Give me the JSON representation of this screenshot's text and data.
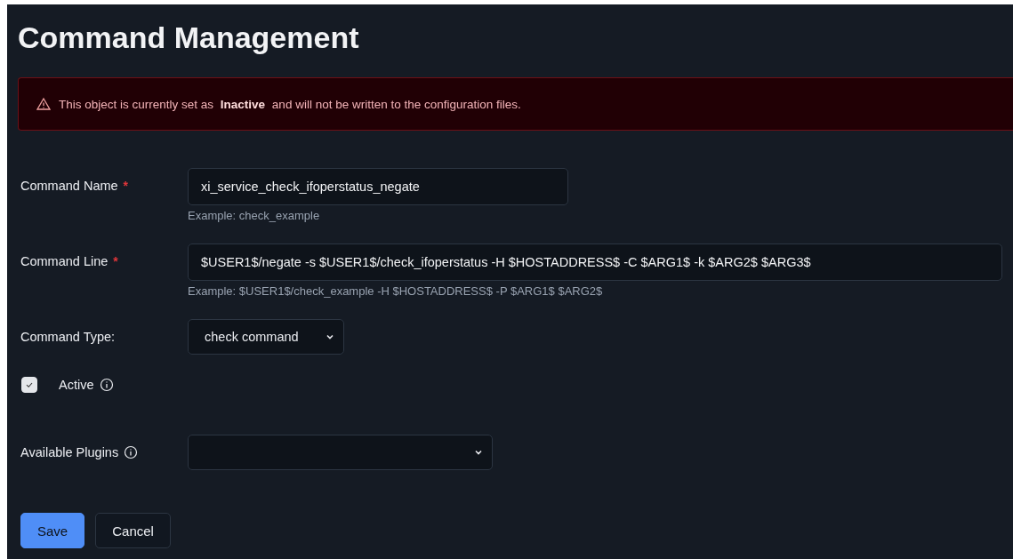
{
  "title": "Command Management",
  "alert": {
    "text": "This object is currently set as **Inactive** and will not be written to the configuration files."
  },
  "fields": [
    {
      "kind": "text",
      "label": "Command Name",
      "required": "*",
      "value": "xi_service_check_ifoperstatus_negate",
      "hint": "Example: check_example"
    },
    {
      "kind": "text",
      "label": "Command Line",
      "required": "*",
      "value": "$USER1$/negate -s $USER1$/check_ifoperstatus -H $HOSTADDRESS$ -C $ARG1$ -k $ARG2$ $ARG3$",
      "hint": "Example: $USER1$/check_example -H $HOSTADDRESS$ -P $ARG1$ $ARG2$"
    },
    {
      "kind": "select",
      "label": "Command Type:",
      "value": "check command"
    },
    {
      "kind": "checkbox",
      "label": "Active",
      "checked": true,
      "info": true
    },
    {
      "kind": "select-wide",
      "label": "Available Plugins",
      "info": true
    }
  ],
  "buttons": [
    {
      "label": "Save",
      "primary": true
    },
    {
      "label": "Cancel",
      "primary": false
    }
  ]
}
